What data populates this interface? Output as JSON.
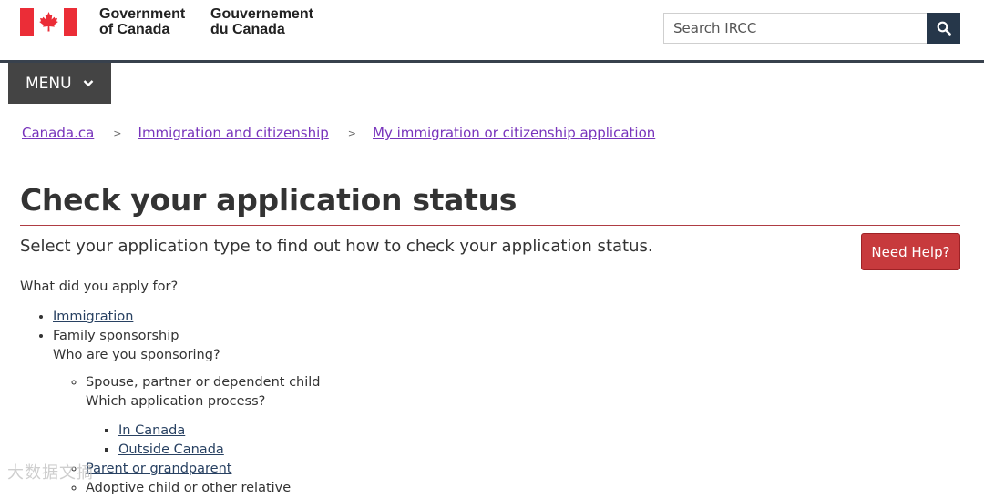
{
  "header": {
    "signature_en_line1": "Government",
    "signature_en_line2": "of Canada",
    "signature_fr_line1": "Gouvernement",
    "signature_fr_line2": "du Canada",
    "search_placeholder": "Search IRCC",
    "search_icon": "search-icon",
    "flag_icon": "canada-flag-icon"
  },
  "menu": {
    "label": "MENU",
    "icon": "chevron-down-icon"
  },
  "breadcrumb": [
    {
      "label": "Canada.ca"
    },
    {
      "label": "Immigration and citizenship"
    },
    {
      "label": "My immigration or citizenship application"
    }
  ],
  "page": {
    "title": "Check your application status",
    "lead": "Select your application type to find out how to check your application status.",
    "help_button": "Need Help?",
    "question": "What did you apply for?"
  },
  "options": {
    "immigration": "Immigration",
    "family_sponsorship": "Family sponsorship",
    "who_sponsoring": "Who are you sponsoring?",
    "spouse": "Spouse, partner or dependent child",
    "which_process": "Which application process?",
    "in_canada": "In Canada",
    "outside_canada": "Outside Canada",
    "parent": "Parent or grandparent",
    "adoptive": "Adoptive child or other relative"
  },
  "watermark": "大数据文摘",
  "colors": {
    "header_dark": "#26374a",
    "menu_bg": "#444444",
    "title_rule": "#af3c43",
    "help_button": "#c73a3d",
    "visited_link": "#7834bc",
    "link": "#284162"
  }
}
